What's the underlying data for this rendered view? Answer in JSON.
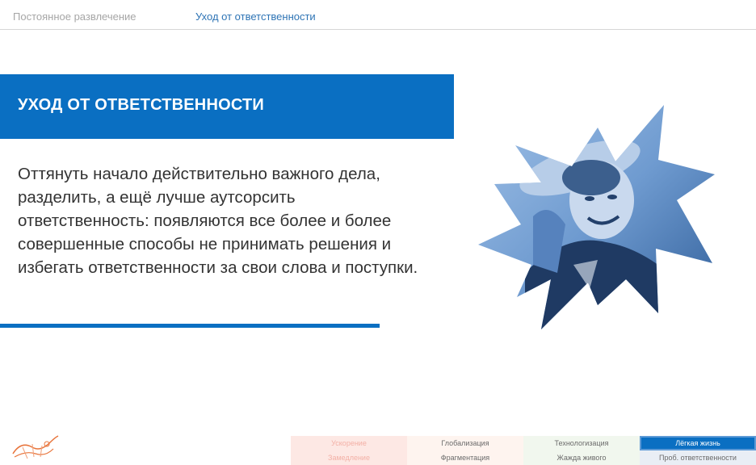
{
  "header": {
    "breadcrumb_first": "Постоянное развлечение",
    "breadcrumb_current": "Уход от ответственности"
  },
  "slide": {
    "title": "УХОД ОТ ОТВЕТСТВЕННОСТИ",
    "lines": [
      "Оттянуть начало действительно важного дела,",
      "разделить, а ещё лучше аутсорсить",
      "ответственность: появляются все более и более",
      "совершенные способы не принимать решения и",
      "избегать ответственности за свои слова и поступки."
    ]
  },
  "nav": {
    "row1": [
      "Ускорение",
      "Глобализация",
      "Технологизация",
      "Лёгкая жизнь"
    ],
    "row2": [
      "Замедление",
      "Фрагментация",
      "Жажда живого",
      "Проб. ответственности"
    ]
  },
  "colors": {
    "accent": "#0a6fc2",
    "photo_tint": "#7aa6d6",
    "breadcrumb_inactive": "#a6a6a6",
    "breadcrumb_active": "#2e74b5",
    "logo": "#e8743b"
  },
  "icons": {
    "logo": "sketch-logo-icon",
    "photo": "starburst-photo"
  }
}
